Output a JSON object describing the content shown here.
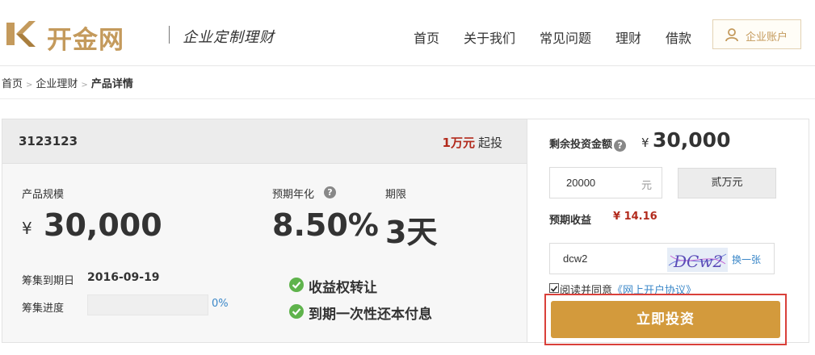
{
  "header": {
    "logo_text": "开金网",
    "slogan": "企业定制理财",
    "nav": [
      "首页",
      "关于我们",
      "常见问题",
      "理财",
      "借款"
    ],
    "account_label": "企业账户"
  },
  "breadcrumb": {
    "items": [
      "首页",
      "企业理财"
    ],
    "separator": ">",
    "current": "产品详情"
  },
  "product": {
    "name": "3123123",
    "min_invest_amount": "1万元",
    "min_invest_suffix": "起投",
    "scale_label": "产品规模",
    "currency_symbol": "¥",
    "scale_value": "30,000",
    "rate_label": "预期年化",
    "rate_value": "8.50%",
    "term_label": "期限",
    "term_value": "3天",
    "deadline_label": "筹集到期日",
    "deadline_value": "2016-09-19",
    "progress_label": "筹集进度",
    "progress_pct": 0,
    "progress_text": "0%",
    "features": [
      "收益权转让",
      "到期一次性还本付息"
    ]
  },
  "invest": {
    "remain_label": "剩余投资金额",
    "remain_currency": "¥",
    "remain_value": "30,000",
    "amount_value": "20000",
    "amount_unit": "元",
    "amount_cn": "贰万元",
    "expect_label": "预期收益",
    "expect_value": "¥ 14.16",
    "captcha_value": "dcw2",
    "captcha_image_text": "DCw2",
    "captcha_refresh": "换一张",
    "agree_checked": true,
    "agree_prefix": "阅读并同意",
    "agree_link": "《网上开户协议》",
    "submit_label": "立即投资"
  },
  "colors": {
    "brand_gold": "#c49a5c",
    "button_gold": "#d39a3c",
    "accent_red": "#b22a1c",
    "link_blue": "#3a87c8",
    "check_green": "#5fb34c",
    "highlight_red": "#d9403a"
  },
  "icons": {
    "logo": "logo-mark-icon",
    "account": "user-icon",
    "help": "help-icon",
    "feature": "check-circle-icon"
  }
}
